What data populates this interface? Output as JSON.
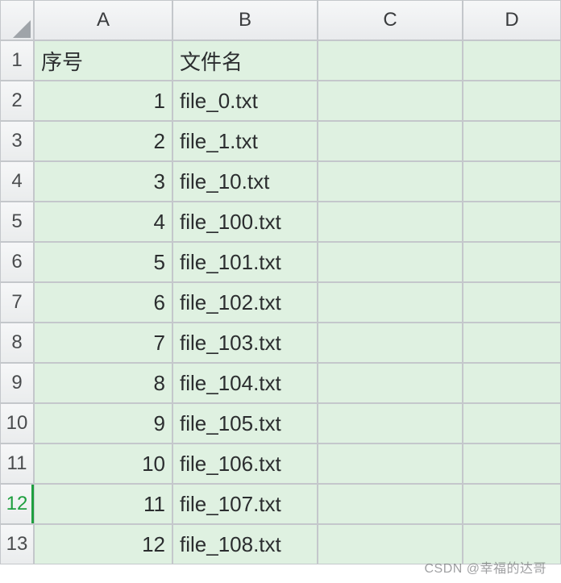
{
  "columns": [
    "A",
    "B",
    "C",
    "D"
  ],
  "header_row": {
    "col_a": "序号",
    "col_b": "文件名"
  },
  "rows": [
    {
      "num": "1",
      "seq": "1",
      "fname": "file_0.txt"
    },
    {
      "num": "2",
      "seq": "2",
      "fname": "file_1.txt"
    },
    {
      "num": "3",
      "seq": "3",
      "fname": "file_10.txt"
    },
    {
      "num": "4",
      "seq": "4",
      "fname": "file_100.txt"
    },
    {
      "num": "5",
      "seq": "5",
      "fname": "file_101.txt"
    },
    {
      "num": "6",
      "seq": "6",
      "fname": "file_102.txt"
    },
    {
      "num": "7",
      "seq": "7",
      "fname": "file_103.txt"
    },
    {
      "num": "8",
      "seq": "8",
      "fname": "file_104.txt"
    },
    {
      "num": "9",
      "seq": "9",
      "fname": "file_105.txt"
    },
    {
      "num": "10",
      "seq": "10",
      "fname": "file_106.txt"
    },
    {
      "num": "11",
      "seq": "11",
      "fname": "file_107.txt"
    },
    {
      "num": "12",
      "seq": "12",
      "fname": "file_108.txt"
    }
  ],
  "active_row": "12",
  "watermark": "CSDN @幸福的达哥"
}
